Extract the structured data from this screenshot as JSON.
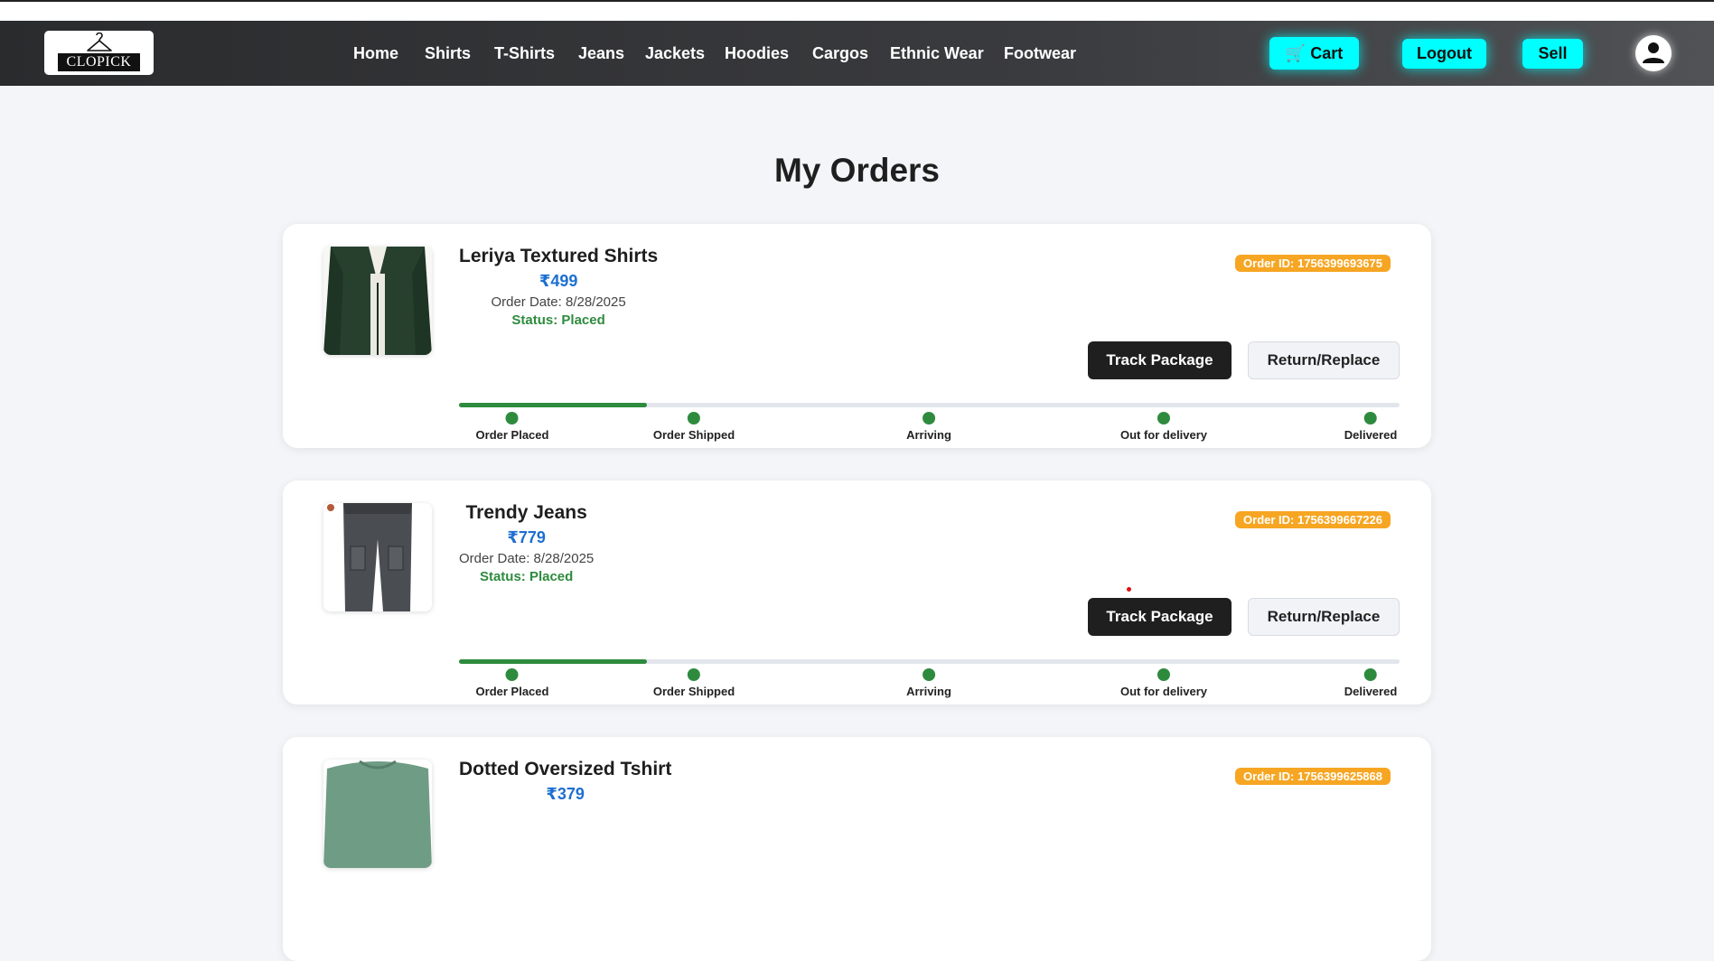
{
  "nav": {
    "logo_text": "CLOPICK",
    "links": [
      "Home",
      "Shirts",
      "T-Shirts",
      "Jeans",
      "Jackets",
      "Hoodies",
      "Cargos",
      "Ethnic Wear",
      "Footwear"
    ],
    "cart_label": "🛒 Cart",
    "logout_label": "Logout",
    "sell_label": "Sell",
    "accent_color": "#00ffff"
  },
  "page": {
    "title": "My Orders"
  },
  "orders": [
    {
      "name": "Leriya Textured Shirts",
      "price": "₹499",
      "date": "Order Date: 8/28/2025",
      "status": "Status: Placed",
      "order_id": "Order ID: 1756399693675",
      "track_label": "Track Package",
      "return_label": "Return/Replace",
      "progress": 0.2,
      "steps": [
        "Order Placed",
        "Order Shipped",
        "Arriving",
        "Out for delivery",
        "Delivered"
      ],
      "image": "jacket-image"
    },
    {
      "name": "Trendy Jeans",
      "price": "₹779",
      "date": "Order Date: 8/28/2025",
      "status": "Status: Placed",
      "order_id": "Order ID: 1756399667226",
      "track_label": "Track Package",
      "return_label": "Return/Replace",
      "progress": 0.2,
      "steps": [
        "Order Placed",
        "Order Shipped",
        "Arriving",
        "Out for delivery",
        "Delivered"
      ],
      "image": "jeans-image"
    },
    {
      "name": "Dotted Oversized Tshirt",
      "price": "₹379",
      "order_id": "Order ID: 1756399625868",
      "image": "tshirt-image"
    }
  ]
}
